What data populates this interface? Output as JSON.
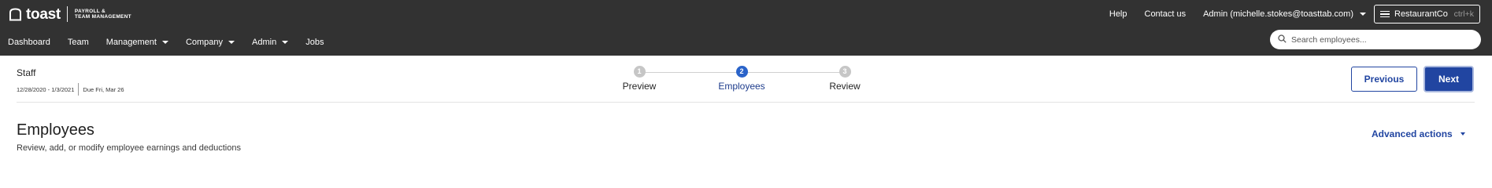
{
  "header": {
    "logo_text": "toast",
    "logo_subtitle_line1": "PAYROLL &",
    "logo_subtitle_line2": "TEAM MANAGEMENT",
    "help_label": "Help",
    "contact_label": "Contact us",
    "admin_label": "Admin (michelle.stokes@toasttab.com)",
    "restaurant_label": "RestaurantCo",
    "restaurant_shortcut": "ctrl+k"
  },
  "nav": {
    "items": [
      {
        "label": "Dashboard",
        "has_dropdown": false
      },
      {
        "label": "Team",
        "has_dropdown": false
      },
      {
        "label": "Management",
        "has_dropdown": true
      },
      {
        "label": "Company",
        "has_dropdown": true
      },
      {
        "label": "Admin",
        "has_dropdown": true
      },
      {
        "label": "Jobs",
        "has_dropdown": false
      }
    ]
  },
  "search": {
    "placeholder": "Search employees...",
    "icon": "search-icon"
  },
  "payroll": {
    "title": "Staff",
    "period": "12/28/2020 - 1/3/2021",
    "due": "Due Fri, Mar 26"
  },
  "stepper": {
    "steps": [
      {
        "number": "1",
        "label": "Preview",
        "state": "inactive"
      },
      {
        "number": "2",
        "label": "Employees",
        "state": "active"
      },
      {
        "number": "3",
        "label": "Review",
        "state": "inactive"
      }
    ]
  },
  "actions": {
    "previous_label": "Previous",
    "next_label": "Next"
  },
  "section": {
    "title": "Employees",
    "subtitle": "Review, add, or modify employee earnings and deductions",
    "advanced_actions_label": "Advanced actions"
  },
  "colors": {
    "header_bg": "#323232",
    "primary_blue": "#2145a1",
    "step_active": "#2a63c9",
    "step_inactive": "#c6c6c6"
  }
}
